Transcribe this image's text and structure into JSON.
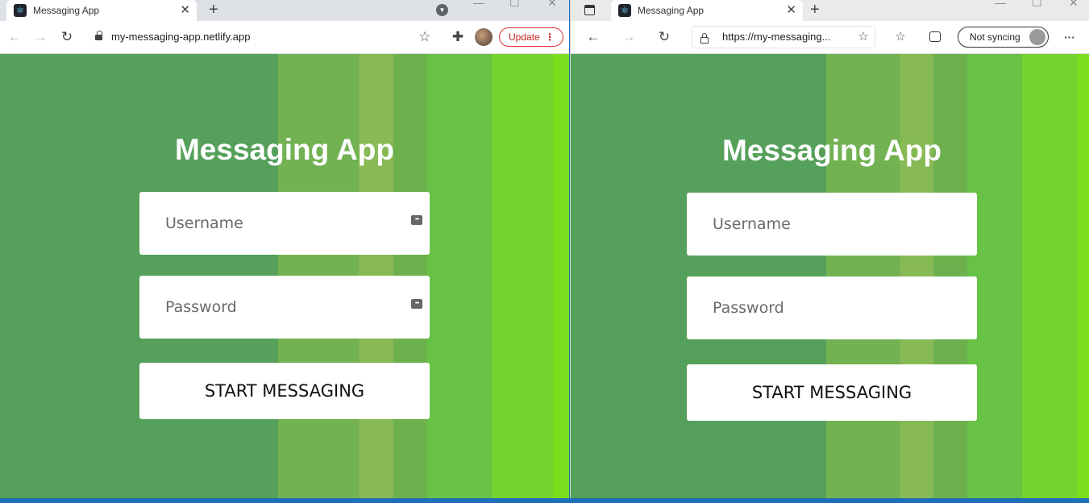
{
  "chrome_window": {
    "tab_title": "Messaging App",
    "tab_close": "✕",
    "new_tab": "+",
    "window_controls": {
      "minimize": "—",
      "maximize": "☐",
      "close": "✕"
    },
    "url": "my-messaging-app.netlify.app",
    "update_label": "Update",
    "update_menu": "⋮",
    "icons": [
      "back-icon",
      "forward-icon",
      "reload-icon",
      "lock-icon",
      "star-icon",
      "extensions-icon",
      "profile-avatar-icon",
      "tab-search-icon"
    ]
  },
  "edge_window": {
    "tab_title": "Messaging App",
    "tab_close": "✕",
    "new_tab": "+",
    "window_controls": {
      "minimize": "—",
      "maximize": "☐",
      "close": "✕"
    },
    "url": "https://my-messaging...",
    "sync_label": "Not syncing",
    "more_label": "···",
    "icons": [
      "tab-actions-icon",
      "back-icon",
      "forward-icon",
      "reload-icon",
      "lock-icon",
      "add-favorite-icon",
      "favorites-icon",
      "collections-icon",
      "profile-icon"
    ]
  },
  "app": {
    "title": "Messaging App",
    "username_placeholder": "Username",
    "password_placeholder": "Password",
    "submit_label": "START MESSAGING"
  },
  "colors": {
    "background_stripes": [
      "#55a05a",
      "#73b253",
      "#87b955",
      "#6db14f",
      "#67c246",
      "#74d331",
      "#7ade1c"
    ],
    "update_button": "#c5221f",
    "taskbar": "#1f6fb8"
  }
}
